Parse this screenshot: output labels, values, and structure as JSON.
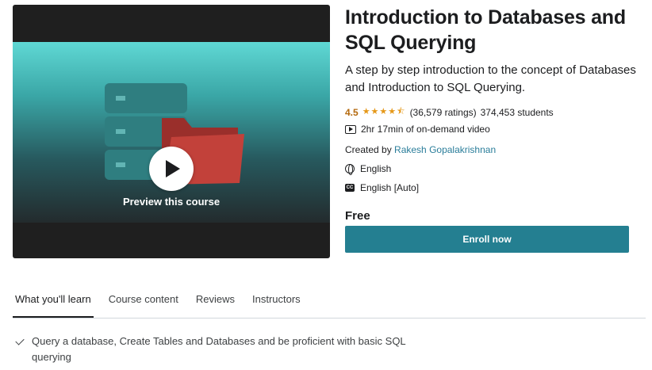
{
  "preview": {
    "label": "Preview this course"
  },
  "course": {
    "title": "Introduction to Databases and SQL Querying",
    "subtitle": "A step by step introduction to the concept of Databases and Introduction to SQL Querying.",
    "rating": "4.5",
    "stars": "★★★★⯪",
    "rating_count": "(36,579 ratings)",
    "students": "374,453 students",
    "video_length": "2hr 17min of on-demand video",
    "created_by_label": "Created by",
    "author": "Rakesh Gopalakrishnan",
    "language": "English",
    "captions": "English [Auto]",
    "cc_badge": "CC",
    "price": "Free",
    "enroll_label": "Enroll now"
  },
  "tabs": [
    {
      "label": "What you'll learn"
    },
    {
      "label": "Course content"
    },
    {
      "label": "Reviews"
    },
    {
      "label": "Instructors"
    }
  ],
  "learn": {
    "items": [
      "Query a database, Create Tables and Databases and be proficient with basic SQL querying"
    ]
  },
  "colors": {
    "accent": "#247f91",
    "rating": "#b4690e",
    "author_link": "#2a7d9a"
  }
}
